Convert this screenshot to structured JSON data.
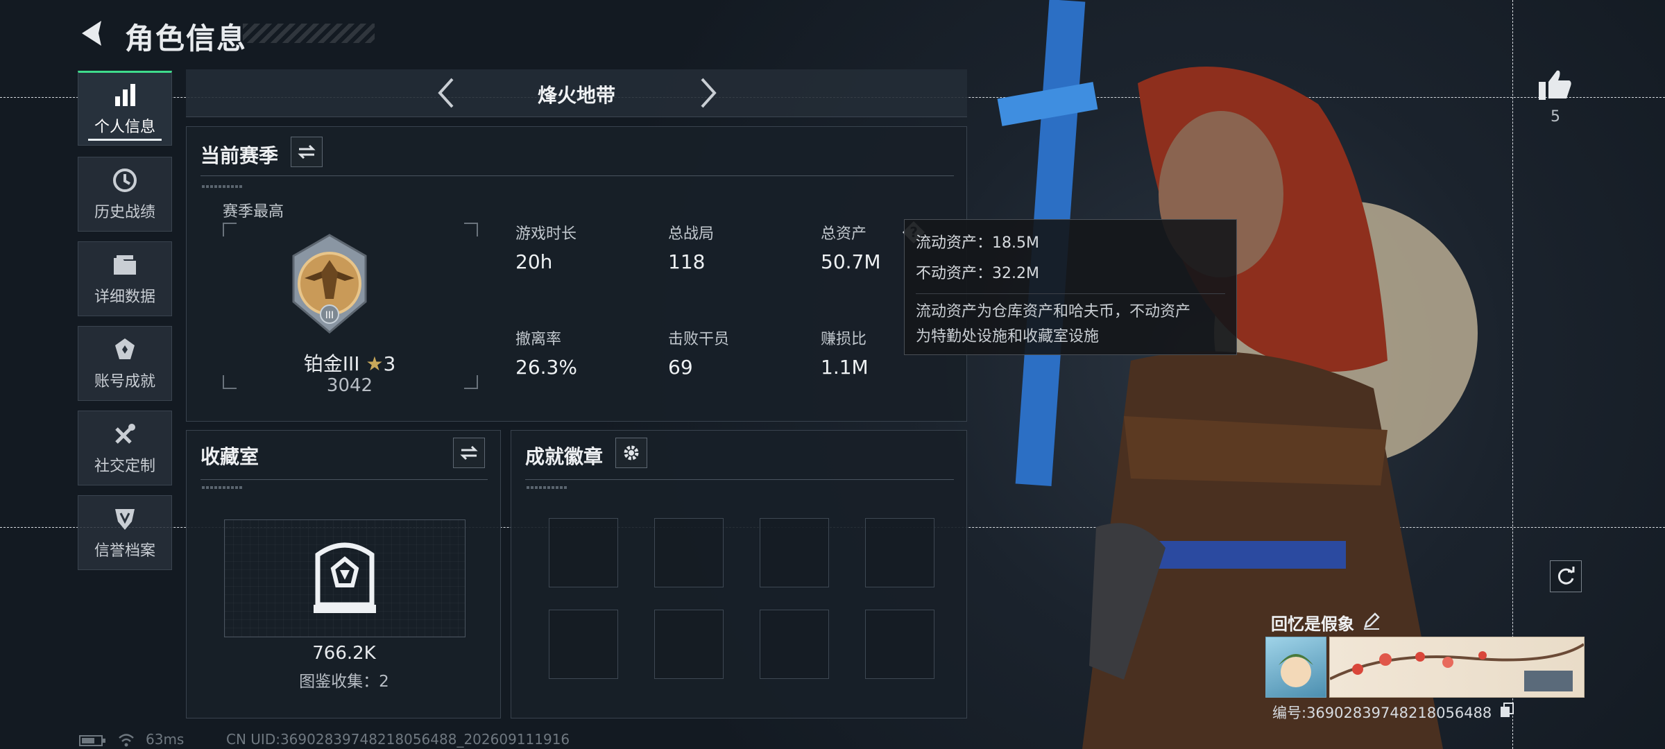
{
  "header": {
    "title": "角色信息"
  },
  "nav": {
    "items": [
      {
        "label": "个人信息",
        "icon": "bar-chart-icon",
        "active": true
      },
      {
        "label": "历史战绩",
        "icon": "history-clock-icon"
      },
      {
        "label": "详细数据",
        "icon": "folder-icon"
      },
      {
        "label": "账号成就",
        "icon": "achievement-icon"
      },
      {
        "label": "社交定制",
        "icon": "tools-icon"
      },
      {
        "label": "信誉档案",
        "icon": "shield-badge-icon"
      }
    ]
  },
  "mode": {
    "title": "烽火地带"
  },
  "season": {
    "title": "当前赛季",
    "best_label": "赛季最高",
    "rank_name": "铂金III",
    "rank_stars": "3",
    "rank_score": "3042",
    "rank_badge_numeral": "III",
    "stats": [
      {
        "label": "游戏时长",
        "value": "20h"
      },
      {
        "label": "总战局",
        "value": "118"
      },
      {
        "label": "总资产",
        "value": "50.7M"
      },
      {
        "label": "撤离率",
        "value": "26.3%"
      },
      {
        "label": "击败干员",
        "value": "69"
      },
      {
        "label": "赚损比",
        "value": "1.1M"
      }
    ]
  },
  "tooltip": {
    "liquid": "流动资产：18.5M",
    "fixed": "不动资产：32.2M",
    "desc_line1": "流动资产为仓库资产和哈夫币，不动资产",
    "desc_line2": "为特勤处设施和收藏室设施"
  },
  "collection": {
    "title": "收藏室",
    "value": "766.2K",
    "catalog": "图鉴收集：2"
  },
  "badges": {
    "title": "成就徽章",
    "slot_count": 8
  },
  "profile": {
    "likes": "5",
    "name": "回忆是假象",
    "id": "编号:3690283974821805648​8"
  },
  "footer": {
    "ping": "63ms",
    "uid": "CN UID:36902839748218056488_202609111916"
  },
  "colors": {
    "accent": "#3fdc8c",
    "gold": "#c99a58"
  }
}
